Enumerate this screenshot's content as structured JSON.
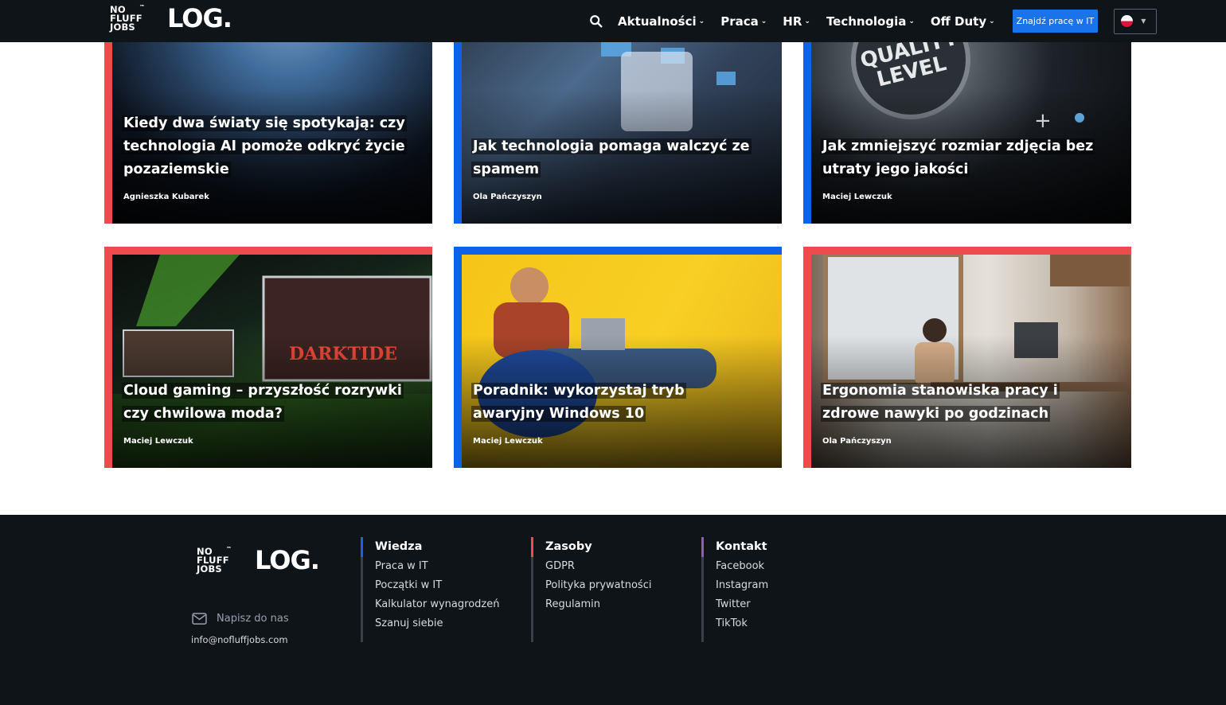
{
  "header": {
    "logo_lines": [
      "NO",
      "FLUFF",
      "JOBS"
    ],
    "logo_tm": "™",
    "logo_word": "LOG.",
    "nav": [
      {
        "label": "Aktualności"
      },
      {
        "label": "Praca"
      },
      {
        "label": "HR"
      },
      {
        "label": "Technologia"
      },
      {
        "label": "Off Duty"
      }
    ],
    "job_button": "Znajdź pracę w IT",
    "icons": {
      "search": "search-icon",
      "chevron": "chevron-down-icon",
      "flag": "poland-flag-icon"
    }
  },
  "articles": [
    {
      "title": "Kiedy dwa światy się spotykają: czy technologia AI pomoże odkryć życie pozaziemskie",
      "author": "Agnieszka Kubarek",
      "accent": "#ef4a4d"
    },
    {
      "title": "Jak technologia pomaga walczyć ze spamem",
      "author": "Ola Pańczyszyn",
      "accent": "#0f62e8"
    },
    {
      "title": "Jak zmniejszyć rozmiar zdjęcia bez utraty jego jakości",
      "author": "Maciej Lewczuk",
      "accent": "#0f62e8"
    },
    {
      "title": "Cloud gaming – przyszłość rozrywki czy chwilowa moda?",
      "author": "Maciej Lewczuk",
      "accent": "#ef4a4d"
    },
    {
      "title": "Poradnik: wykorzystaj tryb awaryjny Windows 10",
      "author": "Maciej Lewczuk",
      "accent": "#0f62e8"
    },
    {
      "title": "Ergonomia stanowiska pracy i zdrowe nawyki po godzinach",
      "author": "Ola Pańczyszyn",
      "accent": "#ef4a4d"
    }
  ],
  "footer": {
    "contact_label": "Napisz do nas",
    "email": "info@nofluffjobs.com",
    "columns": [
      {
        "heading": "Wiedza",
        "accent": "#1a62e0",
        "links": [
          "Praca w IT",
          "Początki w IT",
          "Kalkulator wynagrodzeń",
          "Szanuj siebie"
        ]
      },
      {
        "heading": "Zasoby",
        "accent": "#ef4a4d",
        "links": [
          "GDPR",
          "Polityka prywatności",
          "Regulamin"
        ]
      },
      {
        "heading": "Kontakt",
        "accent": "#8e5fb0",
        "links": [
          "Facebook",
          "Instagram",
          "Twitter",
          "TikTok"
        ]
      }
    ]
  }
}
